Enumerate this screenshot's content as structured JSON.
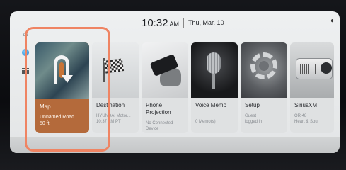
{
  "status": {
    "time": "10:32",
    "meridiem": "AM",
    "date": "Thu, Mar. 10"
  },
  "rail": {
    "icons": [
      "home-icon",
      "globe-icon",
      "menu-icon"
    ]
  },
  "tiles": [
    {
      "title": "Map",
      "line1": "Unnamed Road",
      "line2": "50 ft",
      "icon": "u-turn-icon"
    },
    {
      "title": "Destination",
      "line1": "HYUNDAI Motor...",
      "line2": "10:37 AM PT",
      "icon": "checkered-flag-icon"
    },
    {
      "title": "Phone Projection",
      "line1": "No Connected",
      "line2": "Device",
      "icon": "phone-icon"
    },
    {
      "title": "Voice Memo",
      "line1": "",
      "line2": "0 Memo(s)",
      "icon": "microphone-icon"
    },
    {
      "title": "Setup",
      "line1": "Guest",
      "line2": "logged in",
      "icon": "gear-icon"
    },
    {
      "title": "SiriusXM",
      "line1": "OR 48",
      "line2": "Heart & Soul",
      "icon": "radio-icon"
    }
  ],
  "colors": {
    "highlight": "#ef8463",
    "map_tile": "#b46a3b",
    "screen": "#eef0f1"
  }
}
